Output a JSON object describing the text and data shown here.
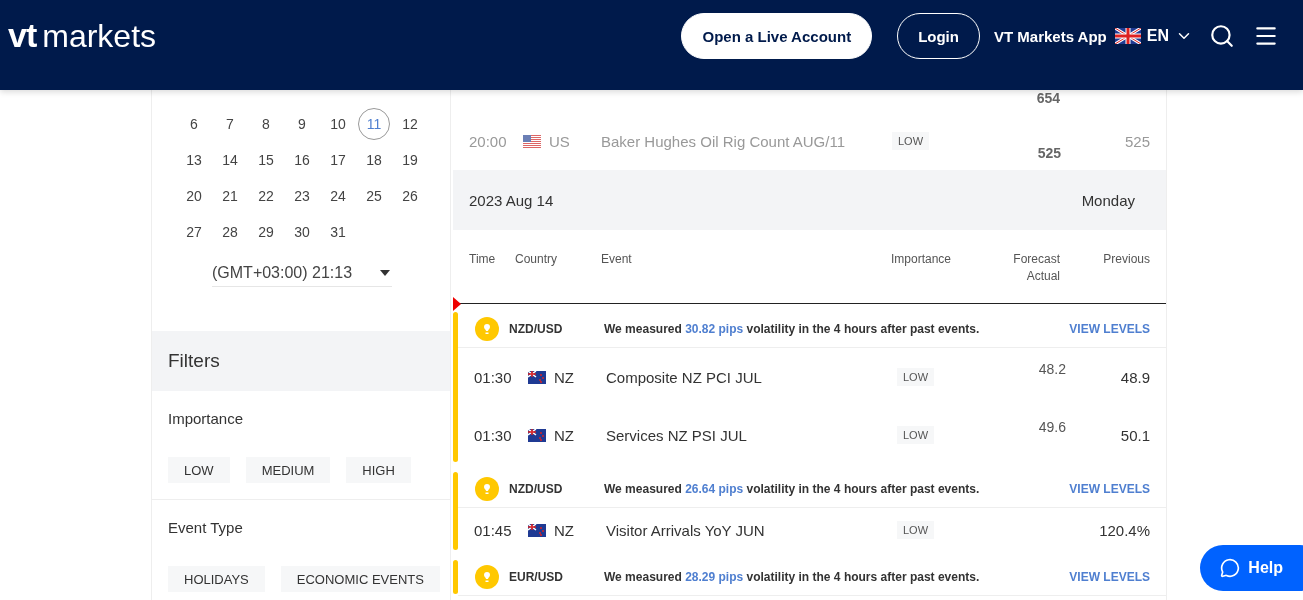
{
  "header": {
    "logo_mark": "vt",
    "logo_word": "markets",
    "open_account": "Open a Live Account",
    "login": "Login",
    "app_link": "VT Markets App",
    "language": "EN"
  },
  "calendar": {
    "weeks": [
      [
        {
          "label": "6",
          "selected": false
        },
        {
          "label": "7",
          "selected": false
        },
        {
          "label": "8",
          "selected": false
        },
        {
          "label": "9",
          "selected": false
        },
        {
          "label": "10",
          "selected": false
        },
        {
          "label": "11",
          "selected": true
        },
        {
          "label": "12",
          "selected": false
        }
      ],
      [
        {
          "label": "13",
          "selected": false
        },
        {
          "label": "14",
          "selected": false
        },
        {
          "label": "15",
          "selected": false
        },
        {
          "label": "16",
          "selected": false
        },
        {
          "label": "17",
          "selected": false
        },
        {
          "label": "18",
          "selected": false
        },
        {
          "label": "19",
          "selected": false
        }
      ],
      [
        {
          "label": "20",
          "selected": false
        },
        {
          "label": "21",
          "selected": false
        },
        {
          "label": "22",
          "selected": false
        },
        {
          "label": "23",
          "selected": false
        },
        {
          "label": "24",
          "selected": false
        },
        {
          "label": "25",
          "selected": false
        },
        {
          "label": "26",
          "selected": false
        }
      ],
      [
        {
          "label": "27",
          "selected": false
        },
        {
          "label": "28",
          "selected": false
        },
        {
          "label": "29",
          "selected": false
        },
        {
          "label": "30",
          "selected": false
        },
        {
          "label": "31",
          "selected": false
        }
      ]
    ],
    "timezone": "(GMT+03:00) 21:13"
  },
  "filters": {
    "title": "Filters",
    "groups": [
      {
        "title": "Importance",
        "chips": [
          "LOW",
          "MEDIUM",
          "HIGH"
        ]
      },
      {
        "title": "Event Type",
        "chips": [
          "HOLIDAYS",
          "ECONOMIC EVENTS"
        ]
      }
    ]
  },
  "table": {
    "earlier_rows": [
      {
        "kind": "cut",
        "actual": "654"
      },
      {
        "kind": "us",
        "past": true,
        "time": "20:00",
        "country": "US",
        "event": "Baker Hughes Oil Rig Count AUG/11",
        "importance": "LOW",
        "actual": "525",
        "previous": "525"
      }
    ],
    "date": "2023 Aug 14",
    "weekday": "Monday",
    "columns": {
      "time": "Time",
      "country": "Country",
      "event": "Event",
      "importance": "Importance",
      "forecast": "Forecast",
      "actual": "Actual",
      "previous": "Previous"
    },
    "groups": [
      {
        "pair": "NZD/USD",
        "message_start": "We measured ",
        "pips": "30.82 pips",
        "message_end": " volatility in the 4 hours after past events.",
        "link": "VIEW LEVELS",
        "events": [
          {
            "kind": "nz",
            "past": false,
            "time": "01:30",
            "country": "NZ",
            "event": "Composite NZ PCI JUL",
            "importance": "LOW",
            "forecast": "48.2",
            "previous": "48.9"
          },
          {
            "kind": "nz",
            "past": false,
            "time": "01:30",
            "country": "NZ",
            "event": "Services NZ PSI JUL",
            "importance": "LOW",
            "forecast": "49.6",
            "previous": "50.1"
          }
        ]
      },
      {
        "pair": "NZD/USD",
        "message_start": "We measured ",
        "pips": "26.64 pips",
        "message_end": " volatility in the 4 hours after past events.",
        "link": "VIEW LEVELS",
        "events": [
          {
            "kind": "nz",
            "past": false,
            "time": "01:45",
            "country": "NZ",
            "event": "Visitor Arrivals YoY JUN",
            "importance": "LOW",
            "previous": "120.4%"
          }
        ]
      },
      {
        "pair": "EUR/USD",
        "message_start": "We measured ",
        "pips": "28.29 pips",
        "message_end": " volatility in the 4 hours after past events.",
        "link": "VIEW LEVELS"
      }
    ]
  },
  "help": "Help"
}
